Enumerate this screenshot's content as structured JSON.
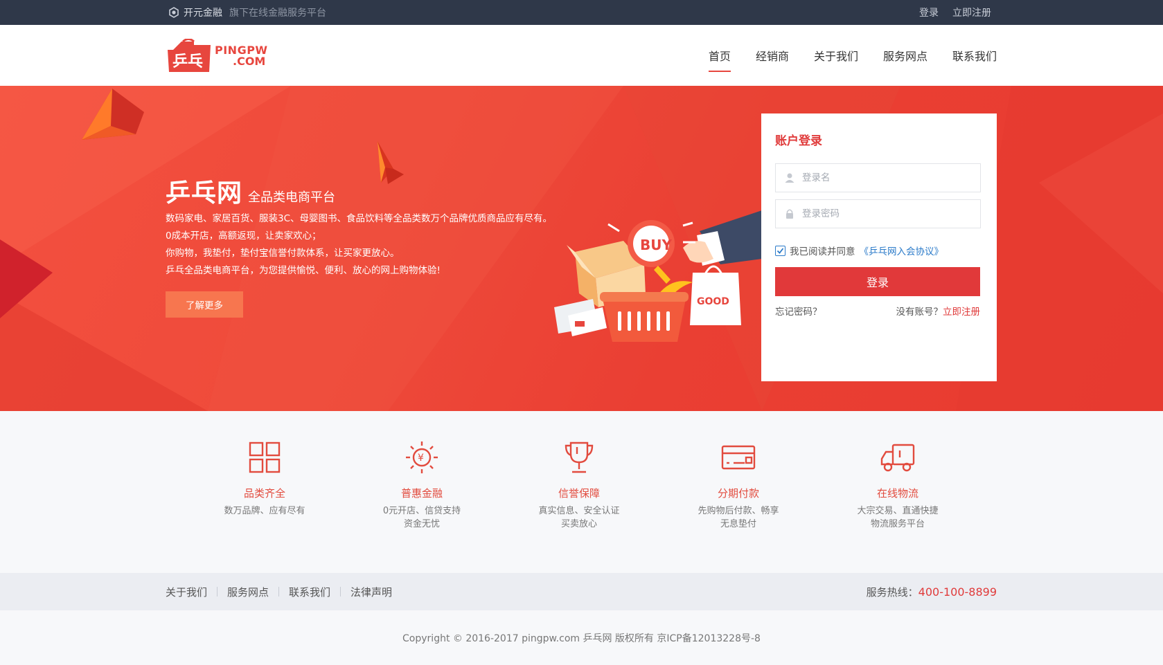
{
  "topbar": {
    "brand_name": "开元金融",
    "brand_sub": "旗下在线金融服务平台",
    "login": "登录",
    "register": "立即注册"
  },
  "header": {
    "logo_text_1": "PINGPW",
    "logo_text_2": ".COM",
    "nav": [
      {
        "label": "首页",
        "active": true
      },
      {
        "label": "经销商"
      },
      {
        "label": "关于我们"
      },
      {
        "label": "服务网点"
      },
      {
        "label": "联系我们"
      }
    ]
  },
  "hero": {
    "title": "乒乓网",
    "subtitle": "全品类电商平台",
    "lines": [
      "数码家电、家居百货、服装3C、母婴图书、食品饮料等全品类数万个品牌优质商品应有尽有。",
      "0成本开店，高额返现，让卖家欢心；",
      "你购物，我垫付，垫付宝信誉付款体系，让买家更放心。",
      "乒乓全品类电商平台，为您提供愉悦、便利、放心的网上购物体验!"
    ],
    "button": "了解更多",
    "illus_buy": "BUY",
    "illus_good": "GOOD"
  },
  "login": {
    "title": "账户登录",
    "username_placeholder": "登录名",
    "password_placeholder": "登录密码",
    "agree_text": "我已阅读并同意",
    "agree_link": "《乒乓网入会协议》",
    "submit": "登录",
    "forgot": "忘记密码？",
    "no_account": "没有账号？",
    "register": "立即注册"
  },
  "features": [
    {
      "icon": "grid-icon",
      "title": "品类齐全",
      "desc": [
        "数万品牌、应有尽有"
      ]
    },
    {
      "icon": "yen-sun-icon",
      "title": "普惠金融",
      "desc": [
        "0元开店、信贷支持",
        "资金无忧"
      ]
    },
    {
      "icon": "trophy-icon",
      "title": "信誉保障",
      "desc": [
        "真实信息、安全认证",
        "买卖放心"
      ]
    },
    {
      "icon": "card-icon",
      "title": "分期付款",
      "desc": [
        "先购物后付款、畅享",
        "无息垫付"
      ]
    },
    {
      "icon": "truck-icon",
      "title": "在线物流",
      "desc": [
        "大宗交易、直通快捷",
        "物流服务平台"
      ]
    }
  ],
  "footer": {
    "links": [
      "关于我们",
      "服务网点",
      "联系我们",
      "法律声明"
    ],
    "hotline_label": "服务热线：",
    "hotline_number": "400-100-8899",
    "copyright": "Copyright © 2016-2017 pingpw.com 乒乓网 版权所有 京ICP备12013228号-8"
  },
  "colors": {
    "accent": "#e03b3b",
    "hero_bg": "#ee4a3a",
    "topbar_bg": "#2f3849"
  }
}
